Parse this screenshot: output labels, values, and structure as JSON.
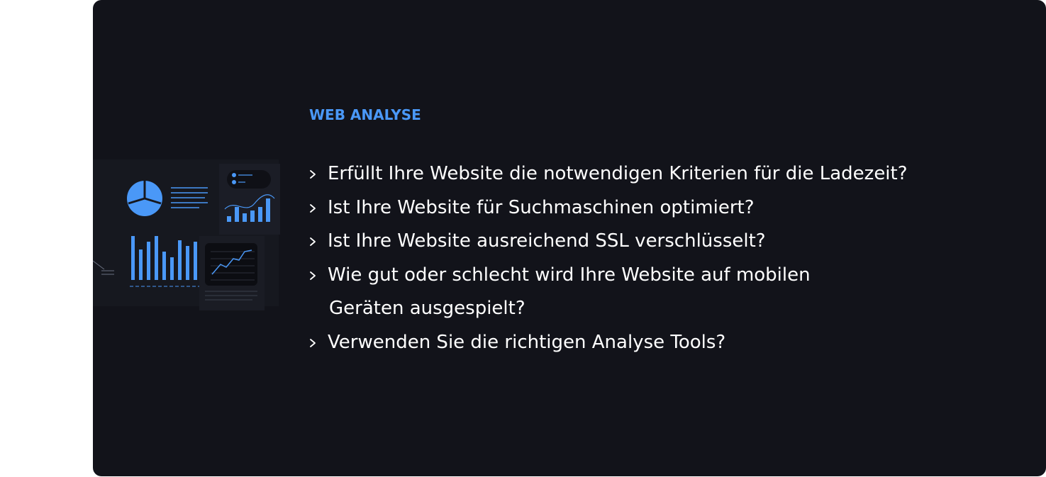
{
  "section": {
    "label": "WEB ANALYSE"
  },
  "questions": [
    {
      "line1": "Erfüllt Ihre Website die notwendigen Kriterien für die Ladezeit?"
    },
    {
      "line1": "Ist Ihre Website für Suchmaschinen optimiert?"
    },
    {
      "line1": "Ist Ihre Website ausreichend SSL verschlüsselt?"
    },
    {
      "line1": "Wie gut oder schlecht wird Ihre Website auf mobilen",
      "line2": "Geräten ausgespielt?"
    },
    {
      "line1": "Verwenden Sie die richtigen Analyse Tools?"
    }
  ],
  "colors": {
    "background": "#12131a",
    "accent": "#4a98f7",
    "text": "#ffffff"
  },
  "icons": {
    "bullet": "chevron-right-icon",
    "illustration": "dashboard-analytics-illustration"
  }
}
